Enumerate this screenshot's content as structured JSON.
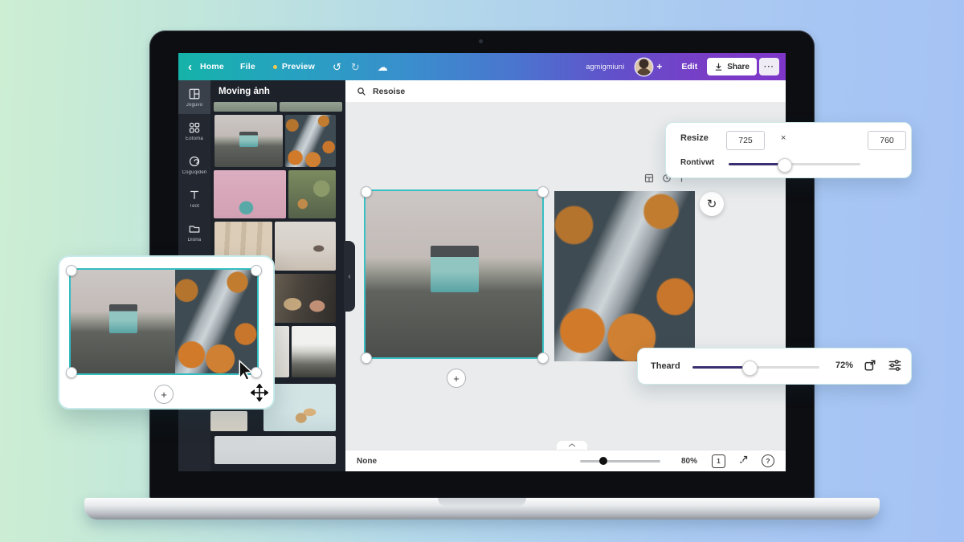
{
  "topbar": {
    "home_label": "Home",
    "file_label": "File",
    "preview_label": "Preview",
    "username": "agmigmiuni",
    "edit_label": "Edit",
    "share_label": "Share",
    "more_label": "···",
    "plus_label": "+"
  },
  "icons": {
    "back": "‹",
    "undo": "↺",
    "redo": "↻",
    "cloud": "☁",
    "collapse": "‹",
    "refresh": "↻",
    "help": "?",
    "plus": "+"
  },
  "sidebar": {
    "items": [
      {
        "label": "Joguvo"
      },
      {
        "label": "Eotoma"
      },
      {
        "label": "Coguqiden"
      },
      {
        "label": "Teot"
      },
      {
        "label": "Diona"
      }
    ]
  },
  "photos_panel": {
    "title": "Moving ảnh"
  },
  "canvas_toolbar": {
    "label": "Resoise"
  },
  "resize_popup": {
    "title": "Resize",
    "width_value": "725",
    "times": "×",
    "height_value": "760",
    "slider_label": "Rontivwt",
    "slider_percent": 42
  },
  "threshold_popup": {
    "label": "Theard",
    "value": "72%",
    "slider_percent": 44
  },
  "statusbar": {
    "left_label": "None",
    "zoom_value": "80%",
    "page_indicator": "1",
    "zoom_slider_percent": 24
  },
  "colors": {
    "topbar_teal": "#15b3a9",
    "topbar_blue": "#3f86cf",
    "topbar_purple": "#7d36c8",
    "selection_teal": "#38c0c4",
    "slider_fill": "#3b2f72",
    "preview_dot": "#f0c94f",
    "sidebar_bg": "#23272f",
    "panel_bg": "#1d2129",
    "canvas_bg": "#e9ebec"
  }
}
